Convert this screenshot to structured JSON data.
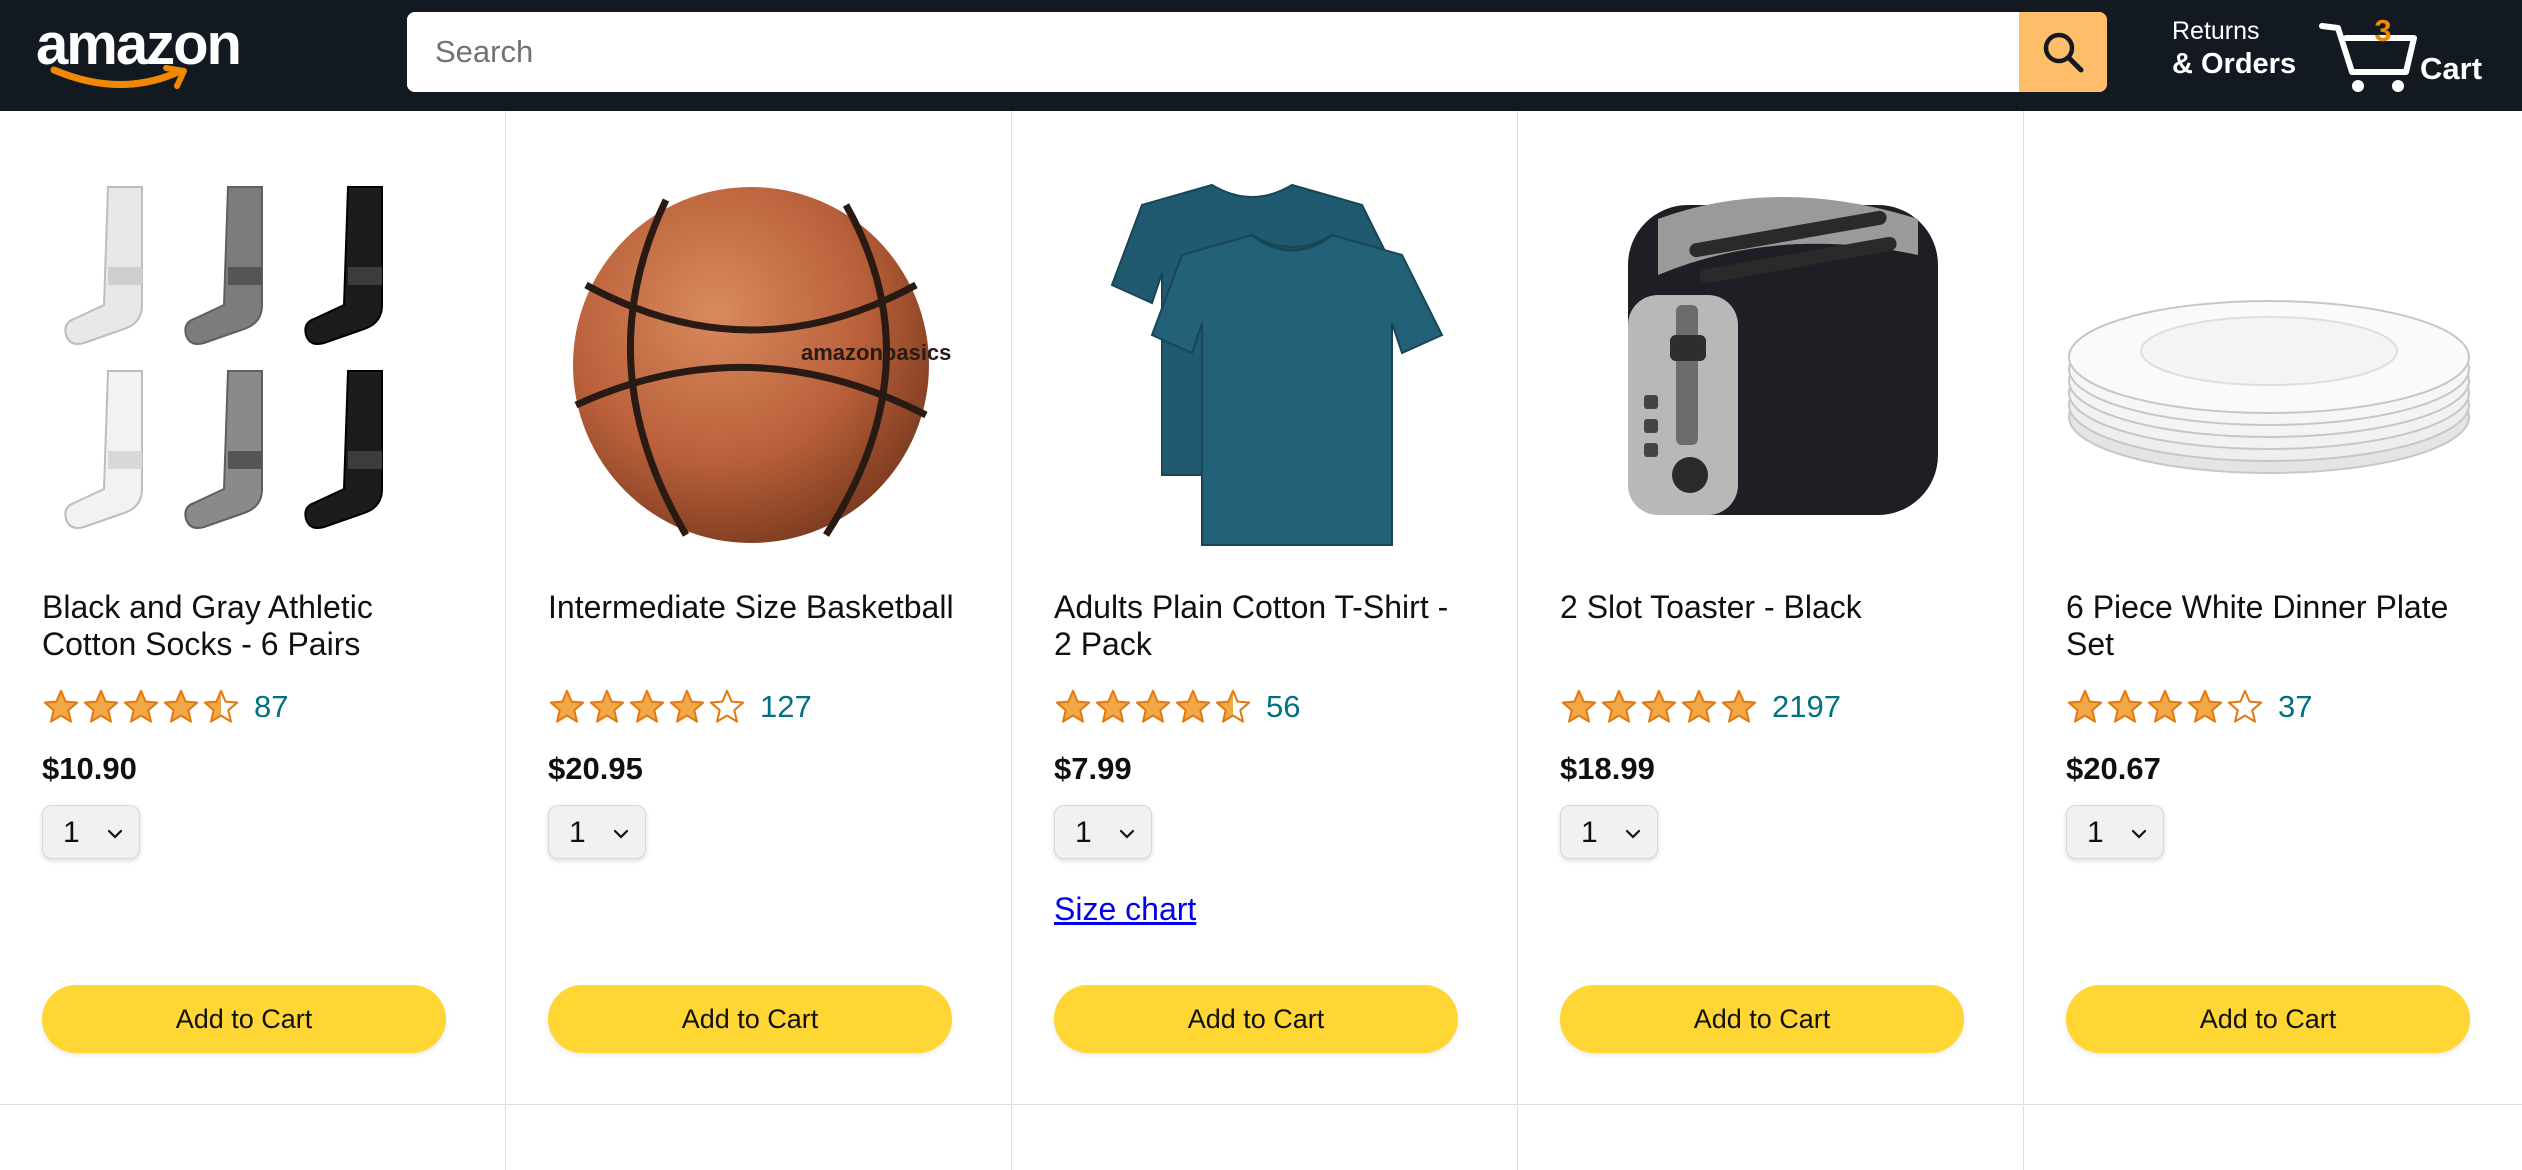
{
  "header": {
    "logo_text": "amazon",
    "search_placeholder": "Search",
    "search_value": "",
    "returns_line1": "Returns",
    "returns_line2": "& Orders",
    "cart_count": "3",
    "cart_label": "Cart"
  },
  "colors": {
    "header_bg": "#131921",
    "search_button": "#febd69",
    "cart_count": "#f08804",
    "star": "#f3a847",
    "rating_link": "#007185",
    "add_to_cart": "#ffd633",
    "size_chart_link": "#0000ee"
  },
  "products": [
    {
      "title": "Black and Gray Athletic Cotton Socks - 6 Pairs",
      "image_icon": "socks-image",
      "rating_stars": 4.5,
      "rating_count": "87",
      "price": "$10.90",
      "quantity": "1",
      "add_to_cart_label": "Add to Cart"
    },
    {
      "title": "Intermediate Size Basketball",
      "image_icon": "basketball-image",
      "rating_stars": 4,
      "rating_count": "127",
      "price": "$20.95",
      "quantity": "1",
      "add_to_cart_label": "Add to Cart"
    },
    {
      "title": "Adults Plain Cotton T-Shirt - 2 Pack",
      "image_icon": "tshirt-image",
      "rating_stars": 4.5,
      "rating_count": "56",
      "price": "$7.99",
      "quantity": "1",
      "size_chart_label": "Size chart",
      "add_to_cart_label": "Add to Cart"
    },
    {
      "title": "2 Slot Toaster - Black",
      "image_icon": "toaster-image",
      "rating_stars": 5,
      "rating_count": "2197",
      "price": "$18.99",
      "quantity": "1",
      "add_to_cart_label": "Add to Cart"
    },
    {
      "title": "6 Piece White Dinner Plate Set",
      "image_icon": "plates-image",
      "rating_stars": 4,
      "rating_count": "37",
      "price": "$20.67",
      "quantity": "1",
      "add_to_cart_label": "Add to Cart"
    }
  ],
  "product_images": {
    "basketball_brand": "amazonbasics"
  }
}
